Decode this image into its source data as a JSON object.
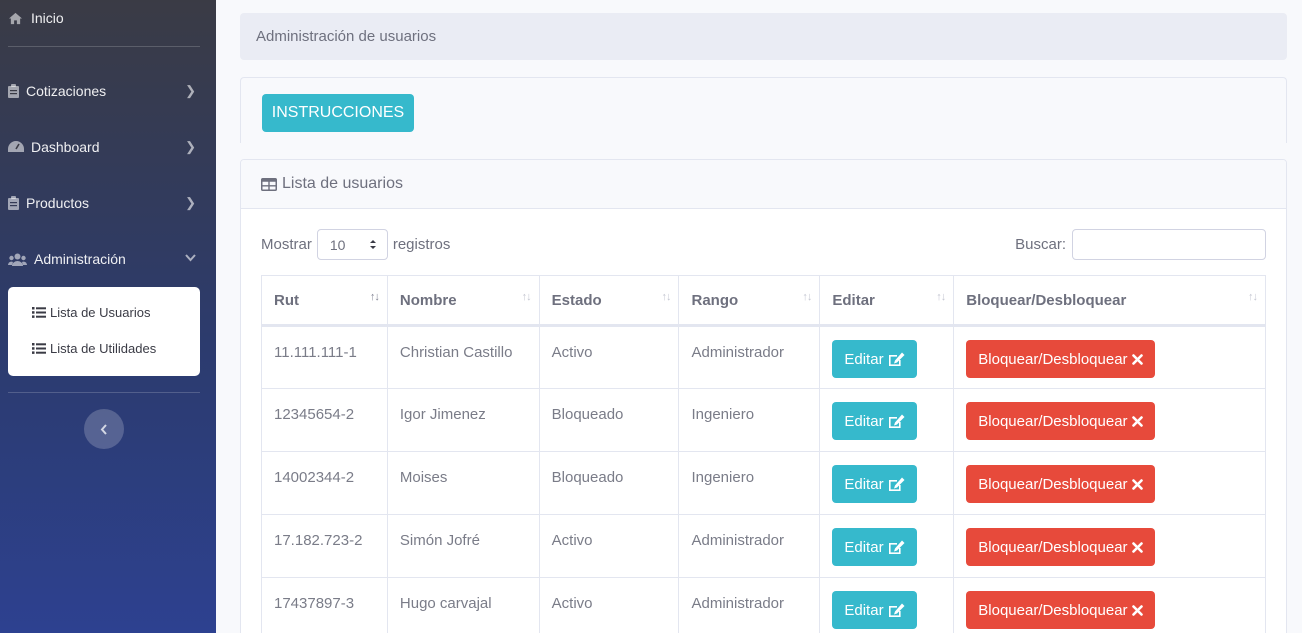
{
  "sidebar": {
    "home_label": "Inicio",
    "items": [
      {
        "label": "Cotizaciones"
      },
      {
        "label": "Dashboard"
      },
      {
        "label": "Productos"
      },
      {
        "label": "Administración"
      }
    ],
    "submenu": [
      {
        "label": "Lista de Usuarios"
      },
      {
        "label": "Lista de Utilidades"
      }
    ]
  },
  "breadcrumb": "Administración de usuarios",
  "instructions_button": "INSTRUCCIONES",
  "list_card": {
    "title": "Lista de usuarios",
    "show_label": "Mostrar",
    "page_size": "10",
    "records_label": "registros",
    "search_label": "Buscar:",
    "search_value": ""
  },
  "table": {
    "headers": [
      "Rut",
      "Nombre",
      "Estado",
      "Rango",
      "Editar",
      "Bloquear/Desbloquear"
    ],
    "edit_label": "Editar",
    "block_label": "Bloquear/Desbloquear",
    "rows": [
      {
        "rut": "11.111.111-1",
        "nombre": "Christian Castillo",
        "estado": "Activo",
        "rango": "Administrador"
      },
      {
        "rut": "12345654-2",
        "nombre": "Igor Jimenez",
        "estado": "Bloqueado",
        "rango": "Ingeniero"
      },
      {
        "rut": "14002344-2",
        "nombre": "Moises",
        "estado": "Bloqueado",
        "rango": "Ingeniero"
      },
      {
        "rut": "17.182.723-2",
        "nombre": "Simón Jofré",
        "estado": "Activo",
        "rango": "Administrador"
      },
      {
        "rut": "17437897-3",
        "nombre": "Hugo carvajal",
        "estado": "Activo",
        "rango": "Administrador"
      }
    ]
  },
  "colors": {
    "info": "#36b9cc",
    "danger": "#e74a3b",
    "sidebar_bottom": "#2d4190"
  }
}
